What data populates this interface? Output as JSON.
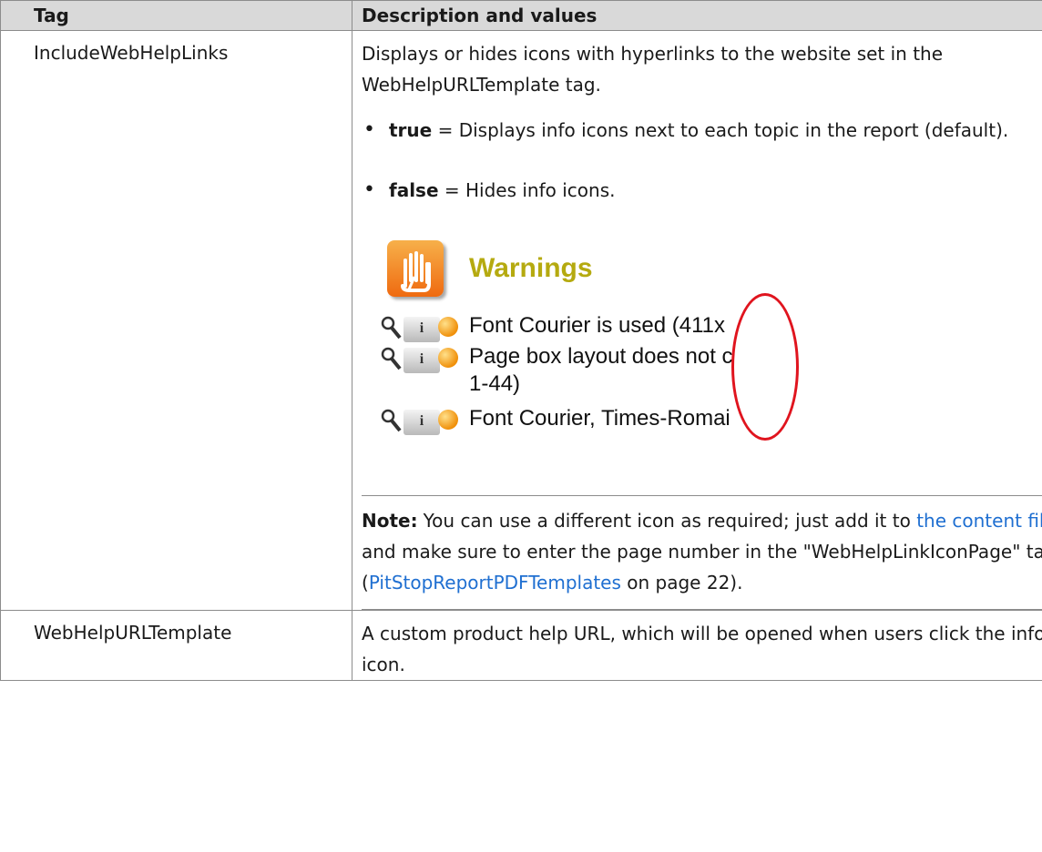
{
  "table": {
    "headers": {
      "tag": "Tag",
      "description": "Description and values"
    },
    "rows": [
      {
        "tag": "IncludeWebHelpLinks",
        "description": "Displays or hides icons with hyperlinks to the website set in the WebHelpURLTemplate tag.",
        "values": [
          {
            "key": "true",
            "text": " = Displays info icons next to each topic in the report (default)."
          },
          {
            "key": "false",
            "text": " = Hides info icons."
          }
        ],
        "screenshot": {
          "title": "Warnings",
          "rows": [
            {
              "text": "Font Courier is used (411x"
            },
            {
              "text": "Page box layout does not c",
              "text2": "1-44)"
            },
            {
              "text": "Font Courier, Times-Romai"
            }
          ],
          "info_glyph": "i",
          "icons": [
            "hand-icon",
            "magnifier-icon",
            "info-icon",
            "warning-ball-icon"
          ],
          "highlight_color": "#e0141e"
        },
        "note": {
          "label": "Note:",
          "text_1": "You can use a different icon as required; just add it to ",
          "link_1": "the content file",
          "text_2": " and make sure to enter the page number in the \"WebHelpLinkIconPage\" tag (",
          "link_2": "PitStopReportPDFTemplates",
          "text_3": " on page 22)."
        }
      },
      {
        "tag": "WebHelpURLTemplate",
        "description": "A custom product help URL, which will be opened when users click the info icon."
      }
    ]
  },
  "colors": {
    "header_bg": "#d9d9d9",
    "link": "#1f6fd1",
    "border": "#8c8c8c",
    "title": "#b5aa10"
  }
}
